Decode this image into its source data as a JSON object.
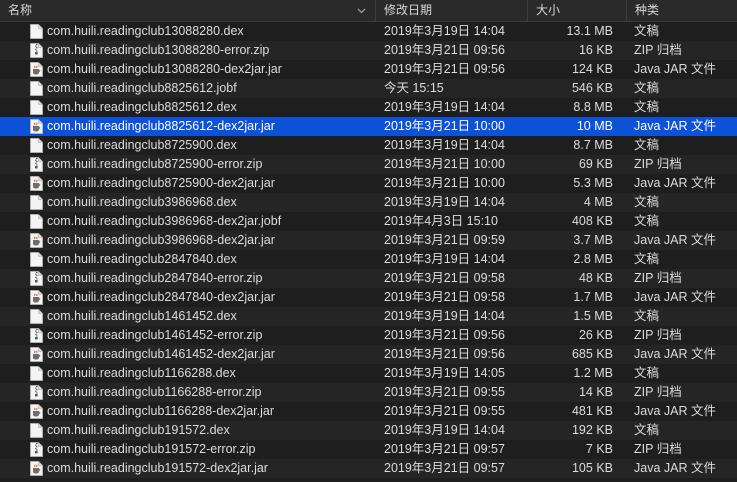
{
  "columns": {
    "name": "名称",
    "date": "修改日期",
    "size": "大小",
    "kind": "种类"
  },
  "selected_index": 5,
  "files": [
    {
      "name": "com.huili.readingclub13088280.dex",
      "date": "2019年3月19日 14:04",
      "size": "13.1 MB",
      "kind": "文稿",
      "icon": "document-icon"
    },
    {
      "name": "com.huili.readingclub13088280-error.zip",
      "date": "2019年3月21日 09:56",
      "size": "16 KB",
      "kind": "ZIP 归档",
      "icon": "zip-archive-icon"
    },
    {
      "name": "com.huili.readingclub13088280-dex2jar.jar",
      "date": "2019年3月21日 09:56",
      "size": "124 KB",
      "kind": "Java JAR 文件",
      "icon": "jar-file-icon"
    },
    {
      "name": "com.huili.readingclub8825612.jobf",
      "date": "今天 15:15",
      "size": "546 KB",
      "kind": "文稿",
      "icon": "document-icon"
    },
    {
      "name": "com.huili.readingclub8825612.dex",
      "date": "2019年3月19日 14:04",
      "size": "8.8 MB",
      "kind": "文稿",
      "icon": "document-icon"
    },
    {
      "name": "com.huili.readingclub8825612-dex2jar.jar",
      "date": "2019年3月21日 10:00",
      "size": "10 MB",
      "kind": "Java JAR 文件",
      "icon": "jar-file-icon"
    },
    {
      "name": "com.huili.readingclub8725900.dex",
      "date": "2019年3月19日 14:04",
      "size": "8.7 MB",
      "kind": "文稿",
      "icon": "document-icon"
    },
    {
      "name": "com.huili.readingclub8725900-error.zip",
      "date": "2019年3月21日 10:00",
      "size": "69 KB",
      "kind": "ZIP 归档",
      "icon": "zip-archive-icon"
    },
    {
      "name": "com.huili.readingclub8725900-dex2jar.jar",
      "date": "2019年3月21日 10:00",
      "size": "5.3 MB",
      "kind": "Java JAR 文件",
      "icon": "jar-file-icon"
    },
    {
      "name": "com.huili.readingclub3986968.dex",
      "date": "2019年3月19日 14:04",
      "size": "4 MB",
      "kind": "文稿",
      "icon": "document-icon"
    },
    {
      "name": "com.huili.readingclub3986968-dex2jar.jobf",
      "date": "2019年4月3日 15:10",
      "size": "408 KB",
      "kind": "文稿",
      "icon": "document-icon"
    },
    {
      "name": "com.huili.readingclub3986968-dex2jar.jar",
      "date": "2019年3月21日 09:59",
      "size": "3.7 MB",
      "kind": "Java JAR 文件",
      "icon": "jar-file-icon"
    },
    {
      "name": "com.huili.readingclub2847840.dex",
      "date": "2019年3月19日 14:04",
      "size": "2.8 MB",
      "kind": "文稿",
      "icon": "document-icon"
    },
    {
      "name": "com.huili.readingclub2847840-error.zip",
      "date": "2019年3月21日 09:58",
      "size": "48 KB",
      "kind": "ZIP 归档",
      "icon": "zip-archive-icon"
    },
    {
      "name": "com.huili.readingclub2847840-dex2jar.jar",
      "date": "2019年3月21日 09:58",
      "size": "1.7 MB",
      "kind": "Java JAR 文件",
      "icon": "jar-file-icon"
    },
    {
      "name": "com.huili.readingclub1461452.dex",
      "date": "2019年3月19日 14:04",
      "size": "1.5 MB",
      "kind": "文稿",
      "icon": "document-icon"
    },
    {
      "name": "com.huili.readingclub1461452-error.zip",
      "date": "2019年3月21日 09:56",
      "size": "26 KB",
      "kind": "ZIP 归档",
      "icon": "zip-archive-icon"
    },
    {
      "name": "com.huili.readingclub1461452-dex2jar.jar",
      "date": "2019年3月21日 09:56",
      "size": "685 KB",
      "kind": "Java JAR 文件",
      "icon": "jar-file-icon"
    },
    {
      "name": "com.huili.readingclub1166288.dex",
      "date": "2019年3月19日 14:05",
      "size": "1.2 MB",
      "kind": "文稿",
      "icon": "document-icon"
    },
    {
      "name": "com.huili.readingclub1166288-error.zip",
      "date": "2019年3月21日 09:55",
      "size": "14 KB",
      "kind": "ZIP 归档",
      "icon": "zip-archive-icon"
    },
    {
      "name": "com.huili.readingclub1166288-dex2jar.jar",
      "date": "2019年3月21日 09:55",
      "size": "481 KB",
      "kind": "Java JAR 文件",
      "icon": "jar-file-icon"
    },
    {
      "name": "com.huili.readingclub191572.dex",
      "date": "2019年3月19日 14:04",
      "size": "192 KB",
      "kind": "文稿",
      "icon": "document-icon"
    },
    {
      "name": "com.huili.readingclub191572-error.zip",
      "date": "2019年3月21日 09:57",
      "size": "7 KB",
      "kind": "ZIP 归档",
      "icon": "zip-archive-icon"
    },
    {
      "name": "com.huili.readingclub191572-dex2jar.jar",
      "date": "2019年3月21日 09:57",
      "size": "105 KB",
      "kind": "Java JAR 文件",
      "icon": "jar-file-icon"
    }
  ]
}
